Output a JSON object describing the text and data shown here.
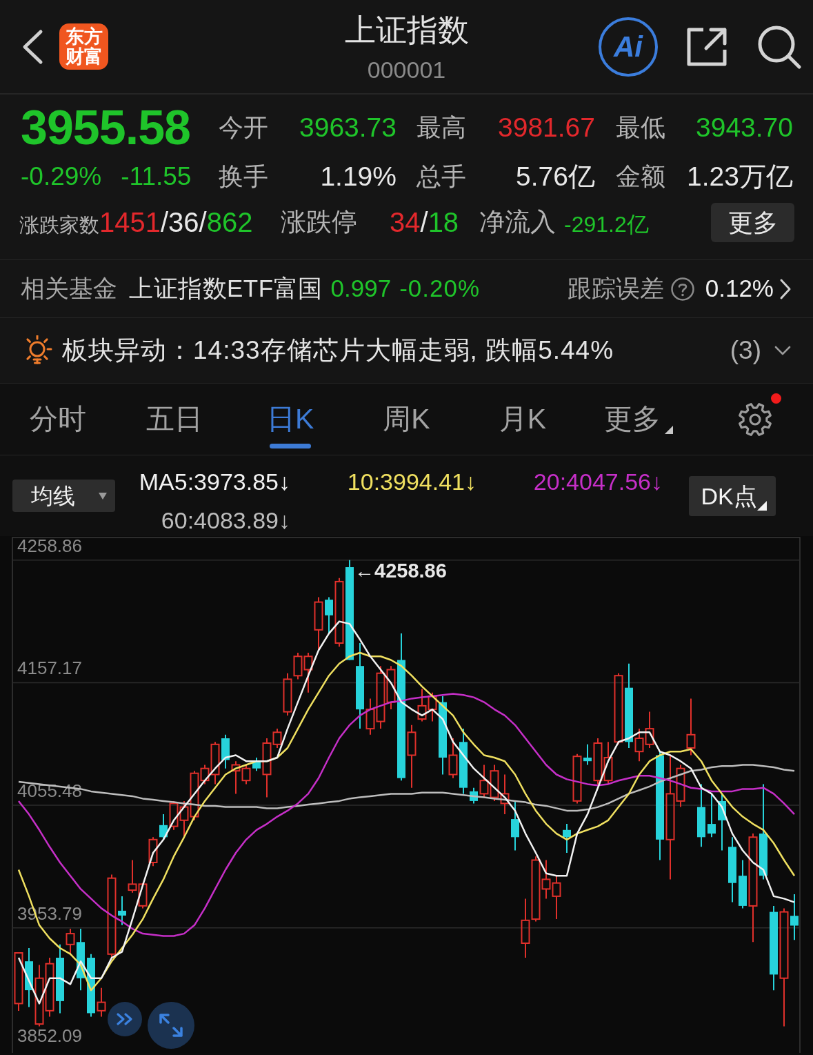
{
  "header": {
    "logo": [
      "东方",
      "财富"
    ],
    "title": "上证指数",
    "code": "000001",
    "ai_label": "Ai"
  },
  "quote": {
    "price": {
      "text": "3955.58",
      "color": "#1fc42a"
    },
    "change_pct": {
      "text": "-0.29%",
      "color": "#1fc42a"
    },
    "change": {
      "text": "-11.55",
      "color": "#1fc42a"
    },
    "stats": [
      {
        "label": "今开",
        "value": "3963.73",
        "color": "#1fc42a"
      },
      {
        "label": "最高",
        "value": "3981.67",
        "color": "#e3282c"
      },
      {
        "label": "最低",
        "value": "3943.70",
        "color": "#1fc42a"
      },
      {
        "label": "换手",
        "value": "1.19%",
        "color": "#e8e8e8"
      },
      {
        "label": "总手",
        "value": "5.76亿",
        "color": "#e8e8e8"
      },
      {
        "label": "金额",
        "value": "1.23万亿",
        "color": "#e8e8e8"
      }
    ],
    "breadth": {
      "label": "涨跌家数",
      "parts": [
        {
          "text": "1451",
          "color": "#e3282c"
        },
        {
          "text": "/36/",
          "color": "#e8e8e8"
        },
        {
          "text": "862",
          "color": "#1fc42a"
        }
      ]
    },
    "limits": {
      "label": "涨跌停",
      "parts": [
        {
          "text": "34",
          "color": "#e3282c"
        },
        {
          "text": "/",
          "color": "#e8e8e8"
        },
        {
          "text": "18",
          "color": "#1fc42a"
        }
      ]
    },
    "net_inflow": {
      "label": "净流入",
      "value": "-291.2亿",
      "color": "#1fc42a"
    },
    "more_button": "更多"
  },
  "fund": {
    "label": "相关基金",
    "name": "上证指数ETF富国",
    "price": "0.997",
    "change": "-0.20%",
    "color": "#1fc42a",
    "tracking_label": "跟踪误差",
    "tracking_value": "0.12%"
  },
  "alert": {
    "text": "板块异动：14:33存储芯片大幅走弱, 跌幅5.44%",
    "count": "(3)"
  },
  "tabs": [
    {
      "label": "分时",
      "selected": false,
      "kind": "plain"
    },
    {
      "label": "五日",
      "selected": false,
      "kind": "plain"
    },
    {
      "label": "日K",
      "selected": true,
      "kind": "plain"
    },
    {
      "label": "周K",
      "selected": false,
      "kind": "plain"
    },
    {
      "label": "月K",
      "selected": false,
      "kind": "plain"
    },
    {
      "label": "更多",
      "selected": false,
      "kind": "menu"
    }
  ],
  "settings": {
    "notification": true
  },
  "indicators": {
    "selector": "均线",
    "values": [
      {
        "text": "MA5:3973.85↓",
        "color": "#f2f2f2"
      },
      {
        "text": "10:3994.41↓",
        "color": "#f0e060"
      },
      {
        "text": "20:4047.56↓",
        "color": "#c62fc8"
      },
      {
        "text": "60:4083.89↓",
        "color": "#bdbdbd"
      }
    ],
    "dk_button": "DK点"
  },
  "chart": {
    "chart_data": {
      "type": "candlestick",
      "ylim": [
        3850.0,
        4277.6
      ],
      "yticks": [
        4258.86,
        4157.17,
        4055.48,
        3953.79,
        3852.09
      ],
      "grid": true,
      "ohlc": [
        [
          3891,
          3933,
          3885,
          3933
        ],
        [
          3926,
          3937,
          3888,
          3902
        ],
        [
          3874,
          3923,
          3872,
          3912
        ],
        [
          3885,
          3929,
          3880,
          3924
        ],
        [
          3929,
          3940,
          3883,
          3893
        ],
        [
          3940,
          3953,
          3932,
          3949
        ],
        [
          3942,
          3953,
          3902,
          3912
        ],
        [
          3929,
          3932,
          3880,
          3883
        ],
        [
          3885,
          3904,
          3880,
          3892
        ],
        [
          3932,
          3998,
          3929,
          3995
        ],
        [
          3968,
          3980,
          3956,
          3964
        ],
        [
          3985,
          4010,
          3983,
          3990
        ],
        [
          3972,
          3991,
          3970,
          3990
        ],
        [
          4008,
          4029,
          4005,
          4027
        ],
        [
          4039,
          4048,
          4027,
          4029
        ],
        [
          4038,
          4059,
          4035,
          4057
        ],
        [
          4043,
          4059,
          4029,
          4054
        ],
        [
          4046,
          4084,
          4043,
          4082
        ],
        [
          4076,
          4089,
          4073,
          4086
        ],
        [
          4081,
          4108,
          4073,
          4106
        ],
        [
          4111,
          4114,
          4086,
          4093
        ],
        [
          4084,
          4092,
          4065,
          4089
        ],
        [
          4076,
          4089,
          4073,
          4086
        ],
        [
          4092,
          4095,
          4084,
          4086
        ],
        [
          4081,
          4111,
          4062,
          4107
        ],
        [
          4106,
          4119,
          4103,
          4116
        ],
        [
          4133,
          4165,
          4130,
          4160
        ],
        [
          4163,
          4182,
          4160,
          4179
        ],
        [
          4168,
          4182,
          4149,
          4179
        ],
        [
          4201,
          4228,
          4184,
          4224
        ],
        [
          4226,
          4228,
          4198,
          4213
        ],
        [
          4190,
          4244,
          4187,
          4241
        ],
        [
          4253,
          4258.86,
          4176,
          4176
        ],
        [
          4171,
          4190,
          4119,
          4135
        ],
        [
          4119,
          4144,
          4114,
          4135
        ],
        [
          4125,
          4171,
          4119,
          4165
        ],
        [
          4141,
          4171,
          4135,
          4168
        ],
        [
          4176,
          4198,
          4076,
          4078
        ],
        [
          4097,
          4122,
          4070,
          4116
        ],
        [
          4127,
          4152,
          4125,
          4138
        ],
        [
          4135,
          4149,
          4125,
          4146
        ],
        [
          4141,
          4146,
          4081,
          4095
        ],
        [
          4081,
          4111,
          4078,
          4097
        ],
        [
          4108,
          4119,
          4065,
          4070
        ],
        [
          4067,
          4070,
          4057,
          4059
        ],
        [
          4065,
          4089,
          4062,
          4076
        ],
        [
          4062,
          4089,
          4059,
          4084
        ],
        [
          4057,
          4081,
          4048,
          4065
        ],
        [
          4044,
          4059,
          4018,
          4029
        ],
        [
          3941,
          3978,
          3929,
          3960
        ],
        [
          3961,
          4013,
          3959,
          4010
        ],
        [
          3986,
          4010,
          3978,
          3994
        ],
        [
          3980,
          3997,
          3961,
          3991
        ],
        [
          4035,
          4040,
          4016,
          4029
        ],
        [
          4059,
          4098,
          4057,
          4096
        ],
        [
          4095,
          4106,
          4089,
          4092
        ],
        [
          4076,
          4111,
          4073,
          4107
        ],
        [
          4076,
          4108,
          4073,
          4095
        ],
        [
          4108,
          4165,
          4106,
          4163
        ],
        [
          4153,
          4173,
          4103,
          4108
        ],
        [
          4100,
          4119,
          4092,
          4111
        ],
        [
          4106,
          4133,
          4103,
          4119
        ],
        [
          4097,
          4100,
          4010,
          4027
        ],
        [
          4027,
          4097,
          3994,
          4065
        ],
        [
          4059,
          4089,
          4054,
          4086
        ],
        [
          4103,
          4144,
          4097,
          4114
        ],
        [
          4054,
          4073,
          4021,
          4029
        ],
        [
          4040,
          4065,
          4029,
          4032
        ],
        [
          4059,
          4065,
          4018,
          4043
        ],
        [
          4021,
          4029,
          3975,
          3991
        ],
        [
          3997,
          4010,
          3970,
          3972
        ],
        [
          3972,
          4032,
          3942,
          4029
        ],
        [
          4032,
          4073,
          3994,
          3997
        ],
        [
          3967,
          3972,
          3902,
          3915
        ],
        [
          3912,
          3970,
          3872,
          3967
        ],
        [
          3963.73,
          3981.67,
          3943.7,
          3955.58
        ]
      ]
    },
    "high_label": "←4258.86"
  },
  "moving_averages": {
    "chart_data": {
      "type": "line",
      "ylim": [
        3850.0,
        4277.6
      ],
      "series": [
        {
          "color": "#f2f2f2",
          "values": [
            3929,
            3910,
            3891,
            3912,
            3912,
            3907,
            3926,
            3912,
            3912,
            3929,
            3934,
            3961,
            3989,
            4016,
            4027,
            4043,
            4054,
            4065,
            4076,
            4086,
            4095,
            4097,
            4092,
            4092,
            4092,
            4095,
            4119,
            4141,
            4163,
            4184,
            4198,
            4208,
            4206,
            4193,
            4179,
            4168,
            4157,
            4141,
            4135,
            4130,
            4135,
            4127,
            4108,
            4097,
            4086,
            4078,
            4070,
            4062,
            4051,
            4032,
            4016,
            3999,
            3997,
            3997,
            4032,
            4048,
            4070,
            4092,
            4108,
            4111,
            4116,
            4116,
            4100,
            4097,
            4092,
            4086,
            4070,
            4065,
            4054,
            4032,
            4018,
            4008,
            4002,
            3980,
            3978,
            3975
          ]
        },
        {
          "color": "#f0e060",
          "values": [
            4002,
            3980,
            3956,
            3945,
            3937,
            3932,
            3923,
            3902,
            3912,
            3926,
            3937,
            3948,
            3961,
            3978,
            3994,
            4013,
            4029,
            4046,
            4059,
            4070,
            4081,
            4086,
            4089,
            4092,
            4092,
            4095,
            4103,
            4119,
            4135,
            4149,
            4163,
            4173,
            4179,
            4182,
            4179,
            4179,
            4176,
            4171,
            4163,
            4154,
            4146,
            4138,
            4130,
            4116,
            4106,
            4097,
            4095,
            4092,
            4081,
            4065,
            4051,
            4040,
            4032,
            4027,
            4032,
            4035,
            4038,
            4043,
            4054,
            4065,
            4081,
            4092,
            4097,
            4100,
            4100,
            4102,
            4092,
            4076,
            4065,
            4054,
            4046,
            4040,
            4035,
            4024,
            4010,
            3997
          ]
        },
        {
          "color": "#c62fc8",
          "values": [
            4059,
            4048,
            4035,
            4021,
            4008,
            3997,
            3986,
            3978,
            3970,
            3964,
            3959,
            3953,
            3949,
            3948,
            3947,
            3947,
            3949,
            3956,
            3970,
            3986,
            4002,
            4016,
            4027,
            4035,
            4040,
            4046,
            4051,
            4057,
            4065,
            4078,
            4095,
            4111,
            4122,
            4130,
            4135,
            4138,
            4141,
            4142,
            4144,
            4145,
            4146,
            4147,
            4148,
            4147,
            4145,
            4141,
            4135,
            4130,
            4122,
            4111,
            4100,
            4089,
            4081,
            4077,
            4075,
            4073,
            4072,
            4073,
            4076,
            4078,
            4080,
            4080,
            4078,
            4076,
            4073,
            4070,
            4069,
            4067,
            4067,
            4067,
            4069,
            4069,
            4070,
            4065,
            4057,
            4048
          ]
        },
        {
          "color": "#bdbdbd",
          "values": [
            4075,
            4074,
            4073,
            4072,
            4071,
            4070,
            4069,
            4067,
            4066,
            4065,
            4064,
            4063,
            4061,
            4060,
            4059,
            4058,
            4057,
            4056,
            4055,
            4055,
            4054,
            4054,
            4054,
            4054,
            4053,
            4053,
            4054,
            4055,
            4056,
            4057,
            4058,
            4059,
            4061,
            4062,
            4063,
            4064,
            4065,
            4065,
            4065,
            4066,
            4066,
            4066,
            4065,
            4064,
            4063,
            4062,
            4061,
            4060,
            4059,
            4058,
            4056,
            4055,
            4053,
            4051,
            4051,
            4052,
            4054,
            4057,
            4061,
            4065,
            4068,
            4071,
            4075,
            4078,
            4081,
            4084,
            4085,
            4087,
            4088,
            4088,
            4089,
            4089,
            4088,
            4087,
            4085,
            4084
          ]
        }
      ]
    }
  }
}
